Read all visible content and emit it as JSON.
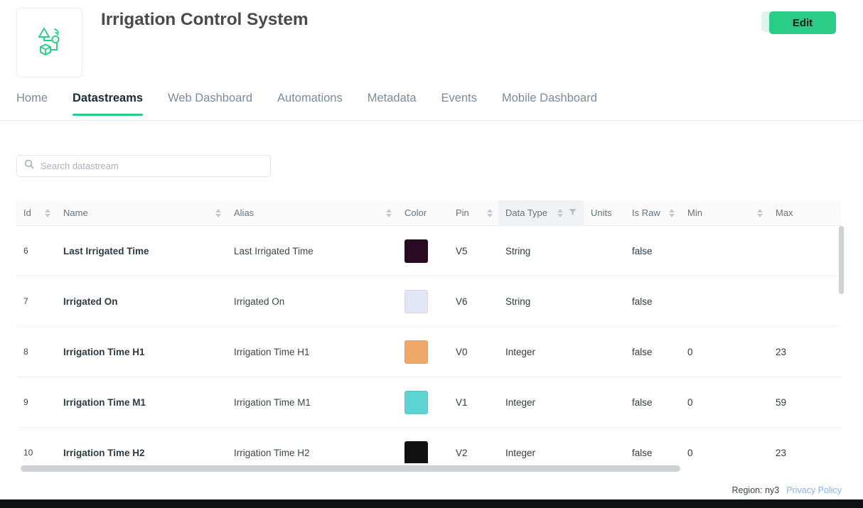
{
  "header": {
    "title": "Irrigation Control System",
    "logo_icon": "iot-device-icon",
    "dots_label": "•••",
    "dots_icon": "more-options-icon",
    "edit_label": "Edit",
    "accent_color": "#2bcc88"
  },
  "tabs": [
    {
      "label": "Home",
      "active": false
    },
    {
      "label": "Datastreams",
      "active": true
    },
    {
      "label": "Web Dashboard",
      "active": false
    },
    {
      "label": "Automations",
      "active": false
    },
    {
      "label": "Metadata",
      "active": false
    },
    {
      "label": "Events",
      "active": false
    },
    {
      "label": "Mobile Dashboard",
      "active": false
    }
  ],
  "search": {
    "placeholder": "Search datastream",
    "value": "",
    "icon": "search-icon"
  },
  "table": {
    "columns": [
      {
        "key": "id",
        "label": "Id",
        "sortable": true,
        "filterable": false,
        "highlight": false
      },
      {
        "key": "name",
        "label": "Name",
        "sortable": true,
        "filterable": false,
        "highlight": false
      },
      {
        "key": "alias",
        "label": "Alias",
        "sortable": true,
        "filterable": false,
        "highlight": false
      },
      {
        "key": "color",
        "label": "Color",
        "sortable": false,
        "filterable": false,
        "highlight": false
      },
      {
        "key": "pin",
        "label": "Pin",
        "sortable": true,
        "filterable": false,
        "highlight": false
      },
      {
        "key": "type",
        "label": "Data Type",
        "sortable": true,
        "filterable": true,
        "highlight": true
      },
      {
        "key": "units",
        "label": "Units",
        "sortable": false,
        "filterable": false,
        "highlight": false
      },
      {
        "key": "raw",
        "label": "Is Raw",
        "sortable": true,
        "filterable": false,
        "highlight": false
      },
      {
        "key": "min",
        "label": "Min",
        "sortable": true,
        "filterable": false,
        "highlight": false
      },
      {
        "key": "max",
        "label": "Max",
        "sortable": false,
        "filterable": false,
        "highlight": false
      }
    ],
    "rows": [
      {
        "id": "6",
        "name": "Last Irrigated Time",
        "alias": "Last Irrigated Time",
        "color": "#2b0a23",
        "pin": "V5",
        "type": "String",
        "units": "",
        "raw": "false",
        "min": "",
        "max": ""
      },
      {
        "id": "7",
        "name": "Irrigated On",
        "alias": "Irrigated On",
        "color": "#e2e6f5",
        "pin": "V6",
        "type": "String",
        "units": "",
        "raw": "false",
        "min": "",
        "max": ""
      },
      {
        "id": "8",
        "name": "Irrigation Time H1",
        "alias": "Irrigation Time H1",
        "color": "#f0a868",
        "pin": "V0",
        "type": "Integer",
        "units": "",
        "raw": "false",
        "min": "0",
        "max": "23"
      },
      {
        "id": "9",
        "name": "Irrigation Time M1",
        "alias": "Irrigation Time M1",
        "color": "#5ed3d3",
        "pin": "V1",
        "type": "Integer",
        "units": "",
        "raw": "false",
        "min": "0",
        "max": "59"
      },
      {
        "id": "10",
        "name": "Irrigation Time H2",
        "alias": "Irrigation Time H2",
        "color": "#111111",
        "pin": "V2",
        "type": "Integer",
        "units": "",
        "raw": "false",
        "min": "0",
        "max": "23"
      }
    ]
  },
  "footer": {
    "region": "Region: ny3",
    "privacy": "Privacy Policy"
  }
}
